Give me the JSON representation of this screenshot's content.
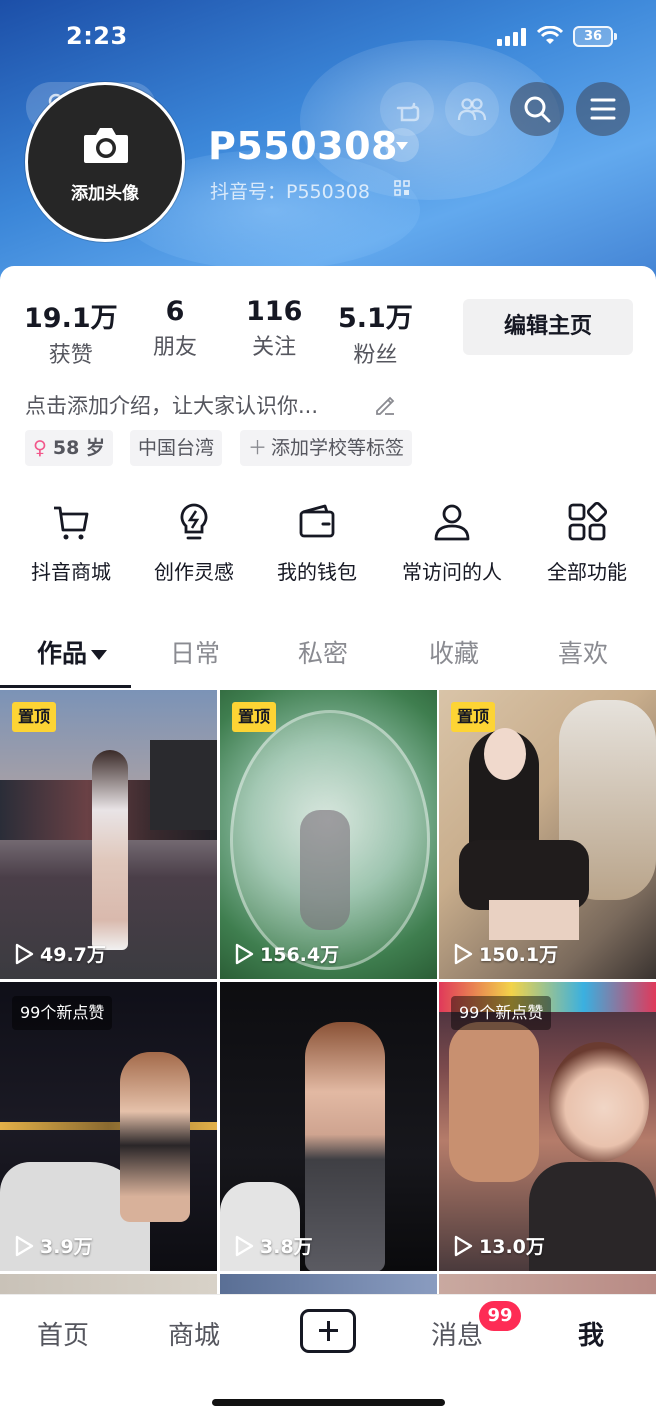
{
  "status_bar": {
    "time": "2:23",
    "battery": "36"
  },
  "header": {
    "friend_button": "朋友",
    "avatar_label": "添加头像",
    "username": "P550308",
    "douyin_id": "抖音号：P550308"
  },
  "stats": [
    {
      "value": "19.1万",
      "label": "获赞"
    },
    {
      "value": "6",
      "label": "朋友"
    },
    {
      "value": "116",
      "label": "关注"
    },
    {
      "value": "5.1万",
      "label": "粉丝"
    }
  ],
  "edit_profile": "编辑主页",
  "bio": "点击添加介绍，让大家认识你...",
  "tags": {
    "age": "58 岁",
    "location": "中国台湾",
    "add_school": "添加学校等标签"
  },
  "features": [
    {
      "icon": "cart-icon",
      "label": "抖音商城"
    },
    {
      "icon": "lightbulb-icon",
      "label": "创作灵感"
    },
    {
      "icon": "wallet-icon",
      "label": "我的钱包"
    },
    {
      "icon": "person-icon",
      "label": "常访问的人"
    },
    {
      "icon": "grid-apps-icon",
      "label": "全部功能"
    }
  ],
  "tabs": [
    "作品",
    "日常",
    "私密",
    "收藏",
    "喜欢"
  ],
  "videos": [
    {
      "badge": "置顶",
      "plays": "49.7万"
    },
    {
      "badge": "置顶",
      "plays": "156.4万"
    },
    {
      "badge": "置顶",
      "plays": "150.1万"
    },
    {
      "badge": "99个新点赞",
      "plays": "3.9万"
    },
    {
      "badge": "",
      "plays": "3.8万"
    },
    {
      "badge": "99个新点赞",
      "plays": "13.0万"
    }
  ],
  "bottom_nav": {
    "home": "首页",
    "mall": "商城",
    "messages": "消息",
    "messages_badge": "99",
    "me": "我"
  }
}
